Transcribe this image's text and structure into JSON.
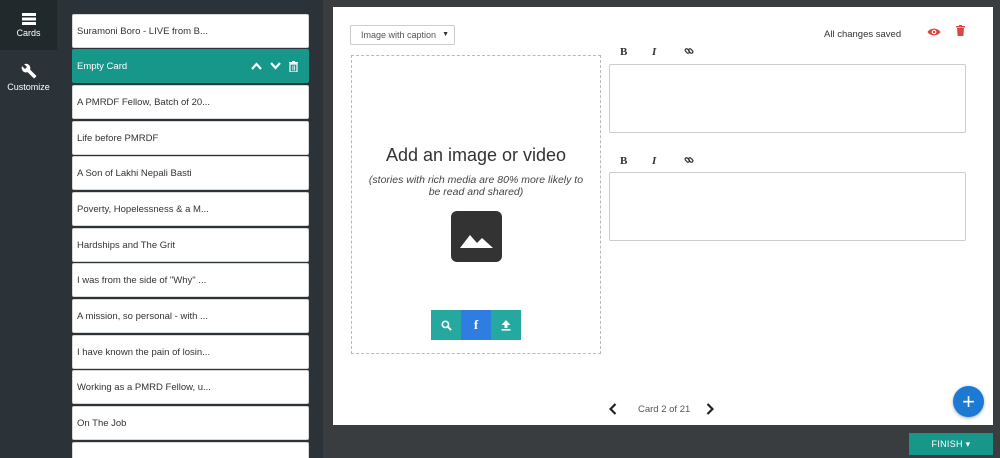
{
  "rail": {
    "cards_label": "Cards",
    "customize_label": "Customize"
  },
  "cards": [
    {
      "title": "Suramoni Boro - LIVE from B...",
      "active": false
    },
    {
      "title": "Empty Card",
      "active": true
    },
    {
      "title": "A PMRDF Fellow, Batch of 20...",
      "active": false
    },
    {
      "title": "Life before PMRDF",
      "active": false
    },
    {
      "title": "A Son of Lakhi Nepali Basti",
      "active": false
    },
    {
      "title": "Poverty, Hopelessness & a M...",
      "active": false
    },
    {
      "title": "Hardships and The Grit",
      "active": false
    },
    {
      "title": "I was from the side of \"Why\" ...",
      "active": false
    },
    {
      "title": "A mission, so personal - with ...",
      "active": false
    },
    {
      "title": "I have known the pain of losin...",
      "active": false
    },
    {
      "title": "Working as a PMRD Fellow, u...",
      "active": false
    },
    {
      "title": "On The Job",
      "active": false
    }
  ],
  "editor": {
    "layout_select": "Image with caption",
    "status": "All changes saved",
    "media_title": "Add an image or video",
    "media_subtitle": "(stories with rich media are 80% more likely to be read and shared)",
    "toolbar": {
      "bold": "B",
      "italic": "I"
    },
    "pager_text": "Card 2 of 21",
    "fab_label": "+",
    "finish_label": "FINISH ▾"
  },
  "colors": {
    "accent_teal": "#17968a",
    "facebook_blue": "#2f7de0",
    "fab_blue": "#1c7ad4",
    "delete_red": "#e0443e"
  },
  "icons": [
    "cards-icon",
    "wrench-icon",
    "chevron-up-icon",
    "chevron-down-icon",
    "trash-icon",
    "eye-icon",
    "image-icon",
    "search-icon",
    "facebook-icon",
    "upload-icon",
    "link-icon",
    "chevron-left-icon",
    "chevron-right-icon",
    "plus-icon"
  ]
}
